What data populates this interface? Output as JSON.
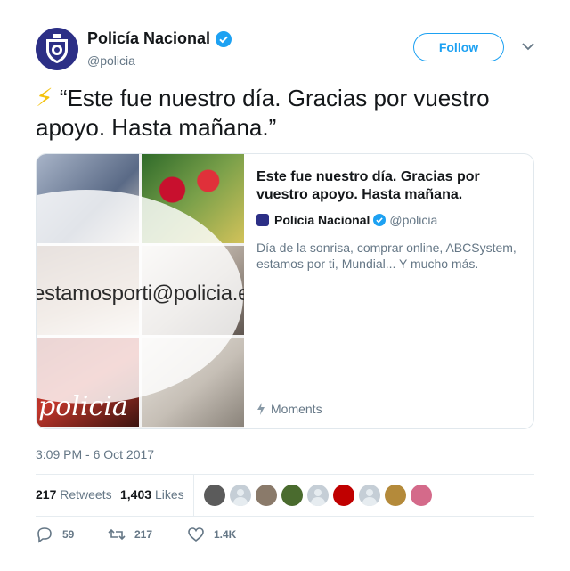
{
  "author": {
    "display_name": "Policía Nacional",
    "handle": "@policia",
    "verified": true,
    "avatar_icon": "police-shield-emblem-icon",
    "brand_color": "#2c2f86"
  },
  "follow_button": {
    "label": "Follow",
    "accent": "#1da1f2"
  },
  "menu_icon": "chevron-down-icon",
  "tweet": {
    "emoji": "⚡",
    "text": "“Este fue nuestro día. Gracias por vuestro apoyo. Hasta mañana.”"
  },
  "card": {
    "title": "Este fue nuestro día. Gracias por vuestro apoyo. Hasta mañana.",
    "author_name": "Policía Nacional",
    "author_handle": "@policia",
    "description": "Día de la sonrisa, comprar online, ABCSystem, estamos por ti, Mundial... Y mucho más.",
    "footer_label": "Moments",
    "image_overlay_text": "estamosporti@policia.es",
    "image_logo_text": "policia"
  },
  "timestamp": "3:09 PM - 6 Oct 2017",
  "stats": {
    "retweets_count": "217",
    "retweets_label": "Retweets",
    "likes_count": "1,403",
    "likes_label": "Likes"
  },
  "liker_avatars": [
    "#5b5b5b",
    "default",
    "#8a7a6a",
    "#4a6b2e",
    "default",
    "#c00000",
    "default",
    "#b48a3a",
    "#d46a8a"
  ],
  "actions": {
    "replies": "59",
    "retweets": "217",
    "likes": "1.4K"
  }
}
